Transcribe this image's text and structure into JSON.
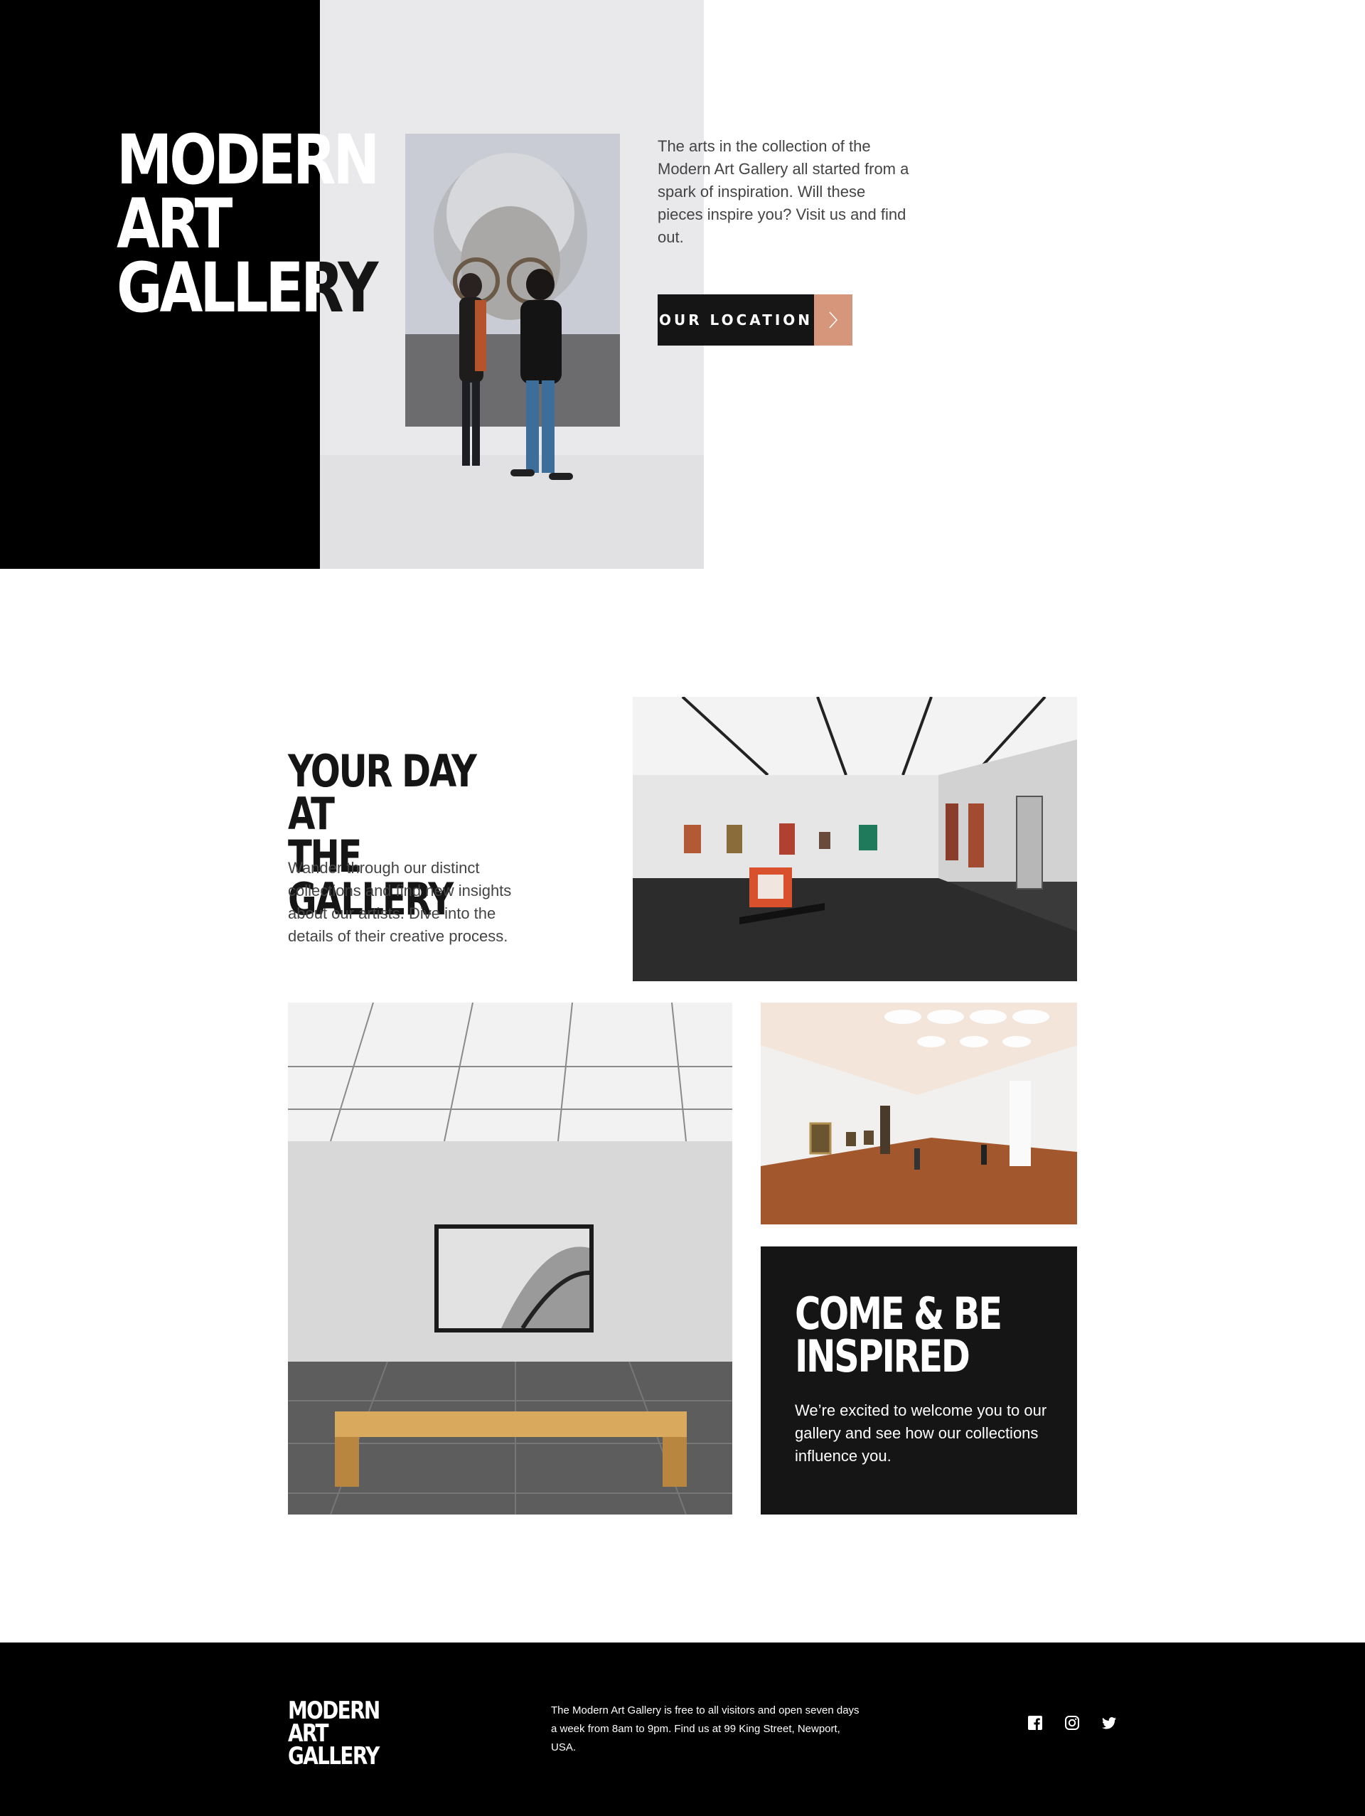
{
  "hero": {
    "title_line1": "Modern",
    "title_line2": "Art Gallery",
    "text": "The arts in the collection of the Modern Art Gallery all started from a spark of inspiration. Will these pieces inspire you? Visit us and find out.",
    "cta_label": "OUR LOCATION",
    "cta_icon": "chevron-right-icon",
    "accent_color": "#d5967b"
  },
  "day_section": {
    "title_line1": "Your day at",
    "title_line2": "the gallery",
    "text": "Wander through our distinct collections and find new insights about our artists. Dive into the details of their creative process."
  },
  "inspire_section": {
    "title_line1": "Come & be",
    "title_line2": "inspired",
    "text": "We’re excited to welcome you to our gallery and see how our collections influence you."
  },
  "footer": {
    "logo_line1": "Modern",
    "logo_line2": "Art Gallery",
    "text": "The Modern Art Gallery is free to all visitors and open seven days a week from 8am to 9pm. Find us at 99 King Street, Newport, USA.",
    "socials": [
      "facebook-icon",
      "instagram-icon",
      "twitter-icon"
    ]
  },
  "colors": {
    "dark": "#151515",
    "black": "#000000",
    "text_grey": "#444444",
    "accent": "#d5967b"
  }
}
